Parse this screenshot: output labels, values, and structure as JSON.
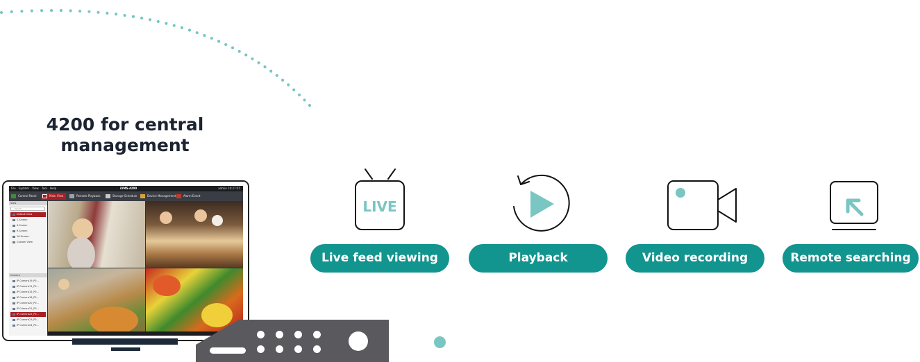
{
  "headline": {
    "line1": "4200 for central",
    "line2": "management"
  },
  "software": {
    "menu_items": [
      "File",
      "System",
      "View",
      "Tool",
      "Help"
    ],
    "window_title": "iVMS-4200",
    "user": "admin",
    "clock": "10:27:55",
    "tabs": [
      "Control Panel",
      "Main View",
      "Remote Playback",
      "Storage Schedule",
      "Device Management",
      "Alarm Event"
    ],
    "active_tab": "Main View",
    "view_pane_label": "View",
    "search_placeholder": "Search",
    "view_items": [
      "Default View",
      "1-Screen",
      "4-Screen",
      "9-Screen",
      "16-Screen",
      "Custom View"
    ],
    "camera_pane_label": "Camera",
    "camera_items": [
      "IP Camera19_P0...",
      "IP Camera11_P0...",
      "IP Camera15_P0...",
      "IP Camera18_P0...",
      "IP Camera20_P0...",
      "IP Camera21_P0...",
      "IP Camera22_P0...",
      "IP Camera23_P0...",
      "IP Camera24_P0..."
    ]
  },
  "features": [
    {
      "label": "Live feed viewing",
      "icon": "live-tv-icon",
      "icon_text": "LIVE"
    },
    {
      "label": "Playback",
      "icon": "playback-icon"
    },
    {
      "label": "Video recording",
      "icon": "video-camera-icon"
    },
    {
      "label": "Remote searching",
      "icon": "remote-search-icon"
    }
  ],
  "colors": {
    "teal": "#12948f",
    "teal_light": "#79c6c2",
    "headline": "#1c2331",
    "nvr": "#5a5a5e",
    "active_tab": "#a81f24"
  }
}
